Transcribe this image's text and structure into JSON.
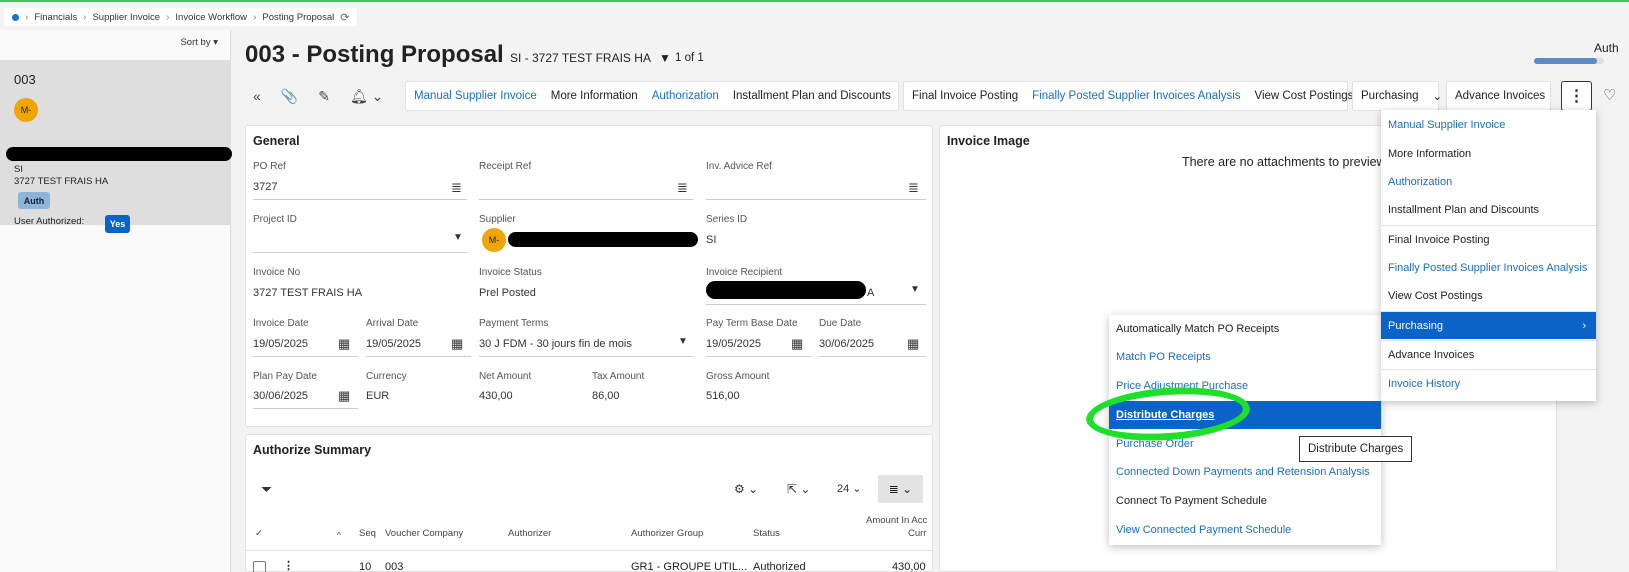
{
  "breadcrumb": [
    "Financials",
    "Supplier Invoice",
    "Invoice Workflow",
    "Posting Proposal"
  ],
  "left_panel": {
    "sort_label": "Sort by",
    "record": {
      "number": "003",
      "avatar": "M-",
      "series": "SI",
      "description": "3727 TEST FRAIS HA",
      "status_badge": "Auth",
      "user_authorized_label": "User Authorized:",
      "user_authorized_value": "Yes"
    }
  },
  "header": {
    "title": "003 - Posting Proposal",
    "subtitle": "SI - 3727 TEST FRAIS HA",
    "pager": "1 of 1",
    "state": "Auth",
    "progress": 0.9
  },
  "toolbar": {
    "group1": [
      "Manual Supplier Invoice",
      "More Information",
      "Authorization",
      "Installment Plan and Discounts"
    ],
    "group2": [
      "Final Invoice Posting",
      "Finally Posted Supplier Invoices Analysis",
      "View Cost Postings"
    ],
    "purchasing": "Purchasing",
    "advance": "Advance Invoices"
  },
  "general": {
    "title": "General",
    "po_ref_label": "PO Ref",
    "po_ref": "3727",
    "receipt_ref_label": "Receipt Ref",
    "receipt_ref": "",
    "inv_advice_label": "Inv. Advice Ref",
    "inv_advice": "",
    "project_label": "Project ID",
    "project": "",
    "supplier_label": "Supplier",
    "supplier_avatar": "M-",
    "series_label": "Series ID",
    "series": "SI",
    "invoice_no_label": "Invoice No",
    "invoice_no": "3727 TEST FRAIS HA",
    "invoice_status_label": "Invoice Status",
    "invoice_status": "Prel Posted",
    "recipient_label": "Invoice Recipient",
    "recipient_tail": "A",
    "invoice_date_label": "Invoice Date",
    "invoice_date": "19/05/2025",
    "arrival_label": "Arrival Date",
    "arrival": "19/05/2025",
    "payment_terms_label": "Payment Terms",
    "payment_terms": "30 J FDM - 30 jours fin de mois",
    "pay_term_base_label": "Pay Term Base Date",
    "pay_term_base": "19/05/2025",
    "due_label": "Due Date",
    "due": "30/06/2025",
    "plan_pay_label": "Plan Pay Date",
    "plan_pay": "30/06/2025",
    "currency_label": "Currency",
    "currency": "EUR",
    "net_label": "Net Amount",
    "net": "430,00",
    "tax_label": "Tax Amount",
    "tax": "86,00",
    "gross_label": "Gross Amount",
    "gross": "516,00"
  },
  "invoice_image": {
    "title": "Invoice Image",
    "empty_text": "There are no attachments to preview"
  },
  "authorize_summary": {
    "title": "Authorize Summary",
    "page_size": "24",
    "columns": [
      "Seq",
      "Voucher Company",
      "Authorizer",
      "Authorizer Group",
      "Status",
      "Amount In Acc",
      "Curr"
    ],
    "rows": [
      {
        "seq": "10",
        "company": "003",
        "authorizer": "",
        "group": "GR1 - GROUPE UTIL...",
        "status": "Authorized",
        "amount": "430,00"
      }
    ]
  },
  "more_menu": {
    "items": [
      {
        "label": "Manual Supplier Invoice",
        "link": true
      },
      {
        "label": "More Information",
        "link": false
      },
      {
        "label": "Authorization",
        "link": true
      },
      {
        "label": "Installment Plan and Discounts",
        "link": false
      },
      {
        "label": "Final Invoice Posting",
        "link": false
      },
      {
        "label": "Finally Posted Supplier Invoices Analysis",
        "link": true
      },
      {
        "label": "View Cost Postings",
        "link": false
      },
      {
        "label": "Purchasing",
        "link": false
      },
      {
        "label": "Advance Invoices",
        "link": false
      },
      {
        "label": "Invoice History",
        "link": true
      }
    ]
  },
  "purchasing_menu": {
    "items": [
      {
        "label": "Automatically Match PO Receipts",
        "link": false
      },
      {
        "label": "Match PO Receipts",
        "link": true
      },
      {
        "label": "Price Adjustment Purchase",
        "link": true
      },
      {
        "label": "Distribute Charges",
        "link": true
      },
      {
        "label": "Purchase Order",
        "link": true
      },
      {
        "label": "Connected Down Payments and Retension Analysis",
        "link": true
      },
      {
        "label": "Connect To Payment Schedule",
        "link": false
      },
      {
        "label": "View Connected Payment Schedule",
        "link": true
      }
    ]
  },
  "tooltip": "Distribute Charges",
  "colors": {
    "accent": "#0b63c7",
    "link": "#1a6fbf",
    "highlight_mark": "#1ee02a",
    "avatar": "#f0a500"
  }
}
